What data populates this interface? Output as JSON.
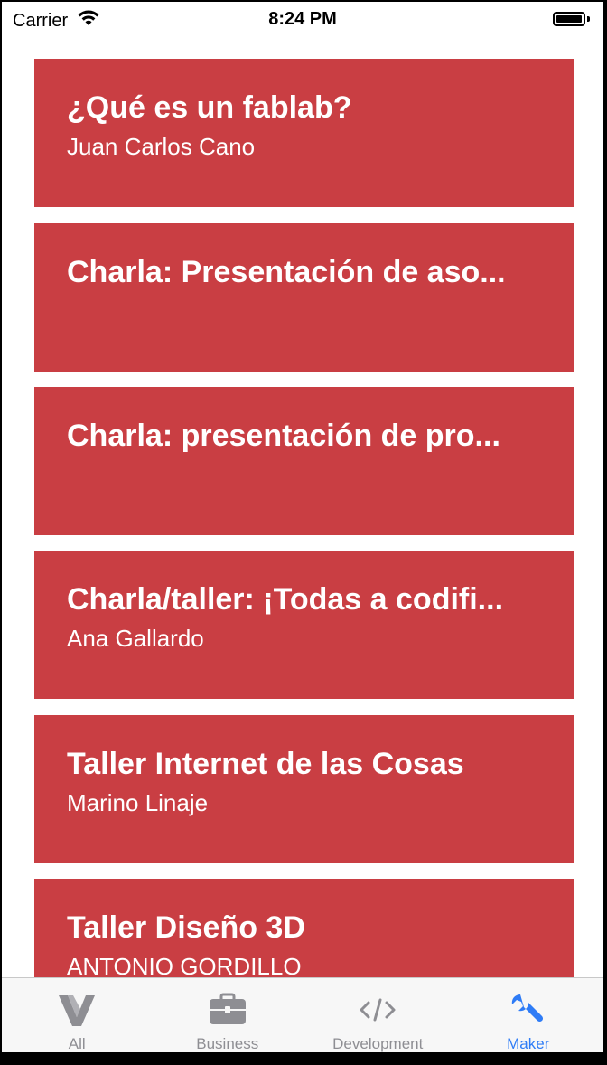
{
  "status_bar": {
    "carrier": "Carrier",
    "time": "8:24 PM"
  },
  "colors": {
    "card_background": "#c93e43",
    "tab_active": "#2f7cf6",
    "tab_inactive": "#8e8e93"
  },
  "sessions": [
    {
      "title": "¿Qué es un fablab?",
      "speaker": "Juan Carlos Cano"
    },
    {
      "title": "Charla: Presentación de aso...",
      "speaker": ""
    },
    {
      "title": "Charla: presentación de pro...",
      "speaker": ""
    },
    {
      "title": "Charla/taller: ¡Todas a codifi...",
      "speaker": "Ana Gallardo"
    },
    {
      "title": "Taller Internet de las Cosas",
      "speaker": "Marino Linaje"
    },
    {
      "title": "Taller Diseño 3D",
      "speaker": "ANTONIO GORDILLO"
    }
  ],
  "tab_bar": {
    "active": "Maker",
    "tabs": [
      {
        "label": "All",
        "icon": "v-logo-icon"
      },
      {
        "label": "Business",
        "icon": "briefcase-icon"
      },
      {
        "label": "Development",
        "icon": "code-icon"
      },
      {
        "label": "Maker",
        "icon": "wrench-icon"
      }
    ]
  }
}
